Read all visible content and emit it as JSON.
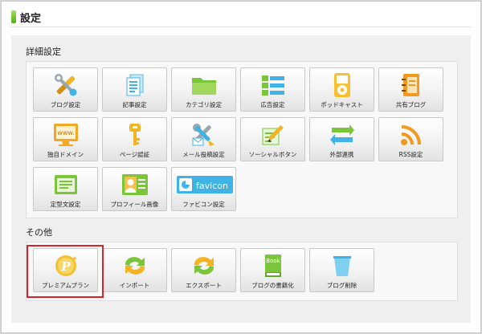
{
  "page": {
    "title": "設定"
  },
  "sections": {
    "detail": {
      "title": "詳細設定",
      "tiles": [
        {
          "label": "ブログ設定",
          "icon": "tools-icon"
        },
        {
          "label": "記事設定",
          "icon": "document-icon"
        },
        {
          "label": "カテゴリ設定",
          "icon": "folder-icon"
        },
        {
          "label": "広告設定",
          "icon": "list-icon"
        },
        {
          "label": "ポッドキャスト",
          "icon": "ipod-icon"
        },
        {
          "label": "共有ブログ",
          "icon": "notebook-icon"
        },
        {
          "label": "独自ドメイン",
          "icon": "www-monitor-icon"
        },
        {
          "label": "ページ認証",
          "icon": "key-icon"
        },
        {
          "label": "メール投稿設定",
          "icon": "mail-tools-icon"
        },
        {
          "label": "ソーシャルボタン",
          "icon": "pencil-note-icon"
        },
        {
          "label": "外部連携",
          "icon": "sync-arrows-icon"
        },
        {
          "label": "RSS設定",
          "icon": "rss-icon"
        },
        {
          "label": "定型文設定",
          "icon": "text-template-icon"
        },
        {
          "label": "プロフィール画像",
          "icon": "profile-card-icon"
        },
        {
          "label": "ファビコン設定",
          "icon": "favicon-icon"
        }
      ]
    },
    "other": {
      "title": "その他",
      "tiles": [
        {
          "label": "プレミアムプラン",
          "icon": "premium-coin-icon"
        },
        {
          "label": "インポート",
          "icon": "import-arrows-icon"
        },
        {
          "label": "エクスポート",
          "icon": "export-arrows-icon"
        },
        {
          "label": "ブログの書籍化",
          "icon": "book-icon"
        },
        {
          "label": "ブログ削除",
          "icon": "trash-icon"
        }
      ]
    }
  },
  "favicon_text": "favicon",
  "book_text": "Book",
  "www_text": "www.",
  "premium_letter": "P",
  "colors": {
    "accent_green": "#6ac02a",
    "highlight_red": "#d8232a",
    "sky_blue": "#3fb3e6"
  }
}
